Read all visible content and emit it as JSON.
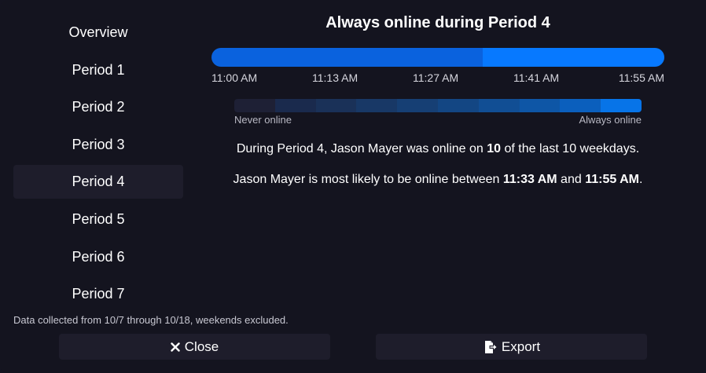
{
  "sidebar": {
    "items": [
      {
        "label": "Overview"
      },
      {
        "label": "Period 1"
      },
      {
        "label": "Period 2"
      },
      {
        "label": "Period 3"
      },
      {
        "label": "Period 4"
      },
      {
        "label": "Period 5"
      },
      {
        "label": "Period 6"
      },
      {
        "label": "Period 7"
      }
    ],
    "active_index": 4
  },
  "main": {
    "title": "Always online during Period 4",
    "timeline": {
      "ticks": [
        "11:00 AM",
        "11:13 AM",
        "11:27 AM",
        "11:41 AM",
        "11:55 AM"
      ],
      "colors": {
        "segment_a": "#0a62de",
        "segment_b": "#0779ff"
      }
    },
    "legend": {
      "min_label": "Never online",
      "max_label": "Always online",
      "colors": [
        "#1e2035",
        "#1a2a4d",
        "#1a3158",
        "#183866",
        "#163f74",
        "#134683",
        "#114e94",
        "#0e56a6",
        "#0b5fbd",
        "#0774e8"
      ]
    },
    "summary": {
      "s1_pre": "During Period 4, Jason Mayer was online on ",
      "s1_bold": "10",
      "s1_post": " of the last 10 weekdays.",
      "s2_pre": "Jason Mayer is most likely to be online between ",
      "s2_start": "11:33 AM",
      "s2_mid": " and ",
      "s2_end": "11:55 AM",
      "s2_post": "."
    }
  },
  "footer": {
    "note": "Data collected from 10/7 through 10/18, weekends excluded.",
    "close_label": "Close",
    "export_label": "Export"
  }
}
